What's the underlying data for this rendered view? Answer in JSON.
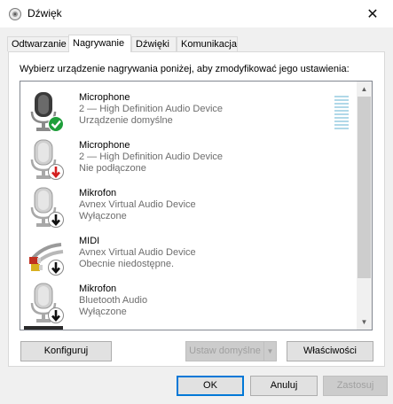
{
  "window": {
    "title": "Dźwięk",
    "app_icon": "speaker-icon",
    "close_icon": "close-icon",
    "close_glyph": "✕"
  },
  "tabs": [
    {
      "label": "Odtwarzanie",
      "active": false
    },
    {
      "label": "Nagrywanie",
      "active": true
    },
    {
      "label": "Dźwięki",
      "active": false
    },
    {
      "label": "Komunikacja",
      "active": false
    }
  ],
  "instruction": "Wybierz urządzenie nagrywania poniżej, aby zmodyfikować jego ustawienia:",
  "devices": [
    {
      "name": "Microphone",
      "description": "2 — High Definition Audio Device",
      "status": "Urządzenie domyślne",
      "icon": "microphone-icon",
      "badge": "check-badge-icon",
      "badge_color": "#1e9e3a",
      "selected": true
    },
    {
      "name": "Microphone",
      "description": "2 — High Definition Audio Device",
      "status": "Nie podłączone",
      "icon": "microphone-icon",
      "badge": "red-down-arrow-badge-icon",
      "badge_color": "#d42020",
      "selected": false
    },
    {
      "name": "Mikrofon",
      "description": "Avnex Virtual Audio Device",
      "status": "Wyłączone",
      "icon": "microphone-icon",
      "badge": "black-down-arrow-badge-icon",
      "badge_color": "#111111",
      "selected": false
    },
    {
      "name": "MIDI",
      "description": "Avnex Virtual Audio Device",
      "status": "Obecnie niedostępne.",
      "icon": "midi-cable-icon",
      "badge": "black-down-arrow-badge-icon",
      "badge_color": "#111111",
      "selected": false
    },
    {
      "name": "Mikrofon",
      "description": "Bluetooth Audio",
      "status": "Wyłączone",
      "icon": "microphone-icon",
      "badge": "black-down-arrow-badge-icon",
      "badge_color": "#111111",
      "selected": false
    }
  ],
  "buttons": {
    "configure": "Konfiguruj",
    "set_default": "Ustaw domyślne",
    "properties": "Właściwości",
    "ok": "OK",
    "cancel": "Anuluj",
    "apply": "Zastosuj"
  },
  "scroll": {
    "up_glyph": "▲",
    "down_glyph": "▼"
  },
  "dropdown_glyph": "▼"
}
